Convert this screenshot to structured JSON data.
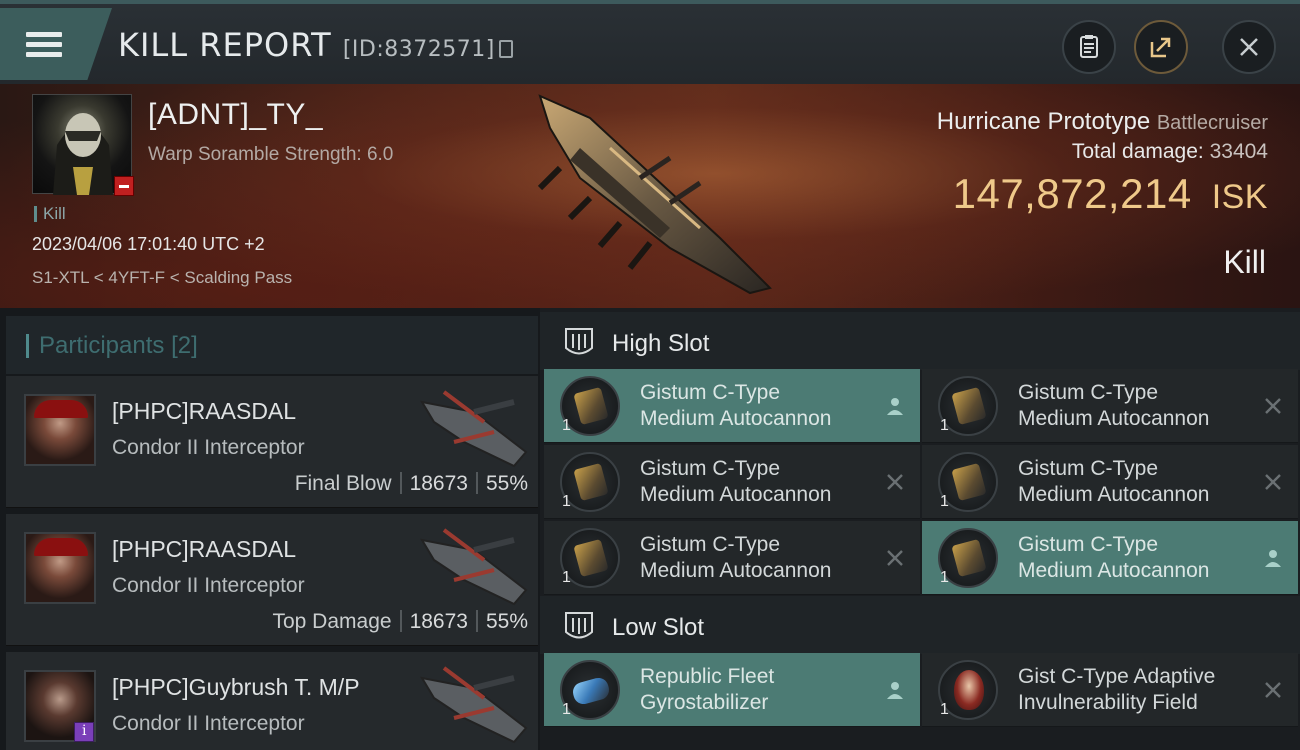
{
  "header": {
    "title": "KILL REPORT",
    "id_text": "[ID:8372571]"
  },
  "victim": {
    "name": "[ADNT]_TY_",
    "warp": "Warp Soramble Strength: 6.0",
    "tag": "Kill",
    "date": "2023/04/06 17:01:40 UTC +2",
    "location": "S1-XTL < 4YFT-F < Scalding Pass",
    "ship_name": "Hurricane Prototype",
    "ship_class": "Battlecruiser",
    "total_damage_label": "Total damage:",
    "total_damage": "33404",
    "isk_value": "147,872,214",
    "isk_unit": "ISK",
    "outcome": "Kill"
  },
  "participants": {
    "label": "Participants",
    "count": "[2]",
    "rows": [
      {
        "name": "[PHPC]RAASDAL",
        "ship": "Condor II Interceptor",
        "label": "Final Blow",
        "damage": "18673",
        "percent": "55%"
      },
      {
        "name": "[PHPC]RAASDAL",
        "ship": "Condor II Interceptor",
        "label": "Top Damage",
        "damage": "18673",
        "percent": "55%"
      },
      {
        "name": "[PHPC]Guybrush T. M/P",
        "ship": "Condor II Interceptor"
      }
    ]
  },
  "high_slot": {
    "label": "High Slot",
    "modules": [
      {
        "line1": "Gistum C-Type",
        "line2": "Medium Autocannon",
        "qty": "1",
        "state": "person-icon"
      },
      {
        "line1": "Gistum C-Type",
        "line2": "Medium Autocannon",
        "qty": "1",
        "state": "close-icon"
      },
      {
        "line1": "Gistum C-Type",
        "line2": "Medium Autocannon",
        "qty": "1",
        "state": "close-icon"
      },
      {
        "line1": "Gistum C-Type",
        "line2": "Medium Autocannon",
        "qty": "1",
        "state": "close-icon"
      },
      {
        "line1": "Gistum C-Type",
        "line2": "Medium Autocannon",
        "qty": "1",
        "state": "close-icon"
      },
      {
        "line1": "Gistum C-Type",
        "line2": "Medium Autocannon",
        "qty": "1",
        "state": "person-icon"
      }
    ]
  },
  "low_slot": {
    "label": "Low Slot",
    "modules": [
      {
        "line1": "Republic Fleet",
        "line2": "Gyrostabilizer",
        "qty": "1",
        "state": "person-icon"
      },
      {
        "line1": "Gist C-Type Adaptive",
        "line2": "Invulnerability Field",
        "qty": "1",
        "state": "close-icon"
      }
    ]
  },
  "colors": {
    "accent_teal": "#4c7b74",
    "isk_gold": "#efc98a"
  }
}
